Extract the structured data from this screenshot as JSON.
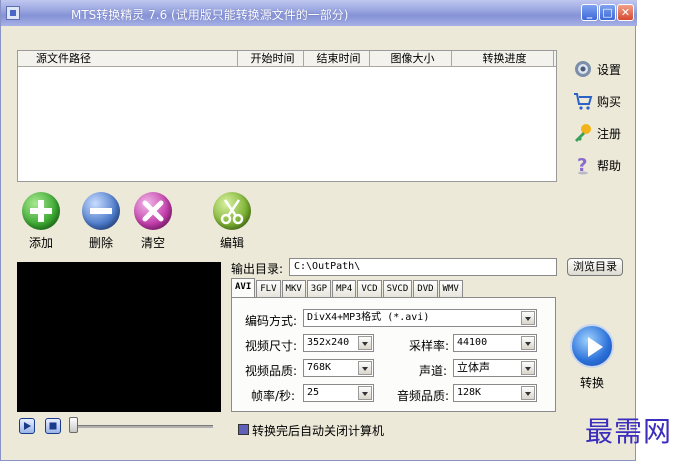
{
  "window": {
    "title": "MTS转换精灵 7.6 (试用版只能转换源文件的一部分)"
  },
  "file_list": {
    "columns": [
      "源文件路径",
      "开始时间",
      "结束时间",
      "图像大小",
      "转换进度"
    ]
  },
  "sidebar": {
    "items": [
      {
        "label": "设置",
        "icon": "gear-icon"
      },
      {
        "label": "购买",
        "icon": "cart-icon"
      },
      {
        "label": "注册",
        "icon": "key-icon"
      },
      {
        "label": "帮助",
        "icon": "help-icon"
      }
    ]
  },
  "actions": {
    "add_label": "添加",
    "delete_label": "删除",
    "clear_label": "清空",
    "edit_label": "编辑"
  },
  "output": {
    "label": "输出目录:",
    "path": "C:\\OutPath\\",
    "browse_label": "浏览目录"
  },
  "format_tabs": {
    "tabs": [
      "AVI",
      "FLV",
      "MKV",
      "3GP",
      "MP4",
      "VCD",
      "SVCD",
      "DVD",
      "WMV"
    ],
    "active": "AVI"
  },
  "settings": {
    "encode_label": "编码方式:",
    "encode_value": "DivX4+MP3格式 (*.avi)",
    "video_size_label": "视频尺寸:",
    "video_size_value": "352x240",
    "sample_rate_label": "采样率:",
    "sample_rate_value": "44100",
    "video_quality_label": "视频品质:",
    "video_quality_value": "768K",
    "channel_label": "声道:",
    "channel_value": "立体声",
    "fps_label": "帧率/秒:",
    "fps_value": "25",
    "audio_quality_label": "音频品质:",
    "audio_quality_value": "128K"
  },
  "convert": {
    "label": "转换"
  },
  "footer": {
    "shutdown_label": "转换完后自动关闭计算机",
    "shutdown_checked": true
  },
  "watermark": {
    "text": "最需网"
  },
  "colors": {
    "add": "#3aa630",
    "delete": "#4a78c8",
    "clear": "#c03aa8",
    "convert": "#2a6fd8"
  }
}
